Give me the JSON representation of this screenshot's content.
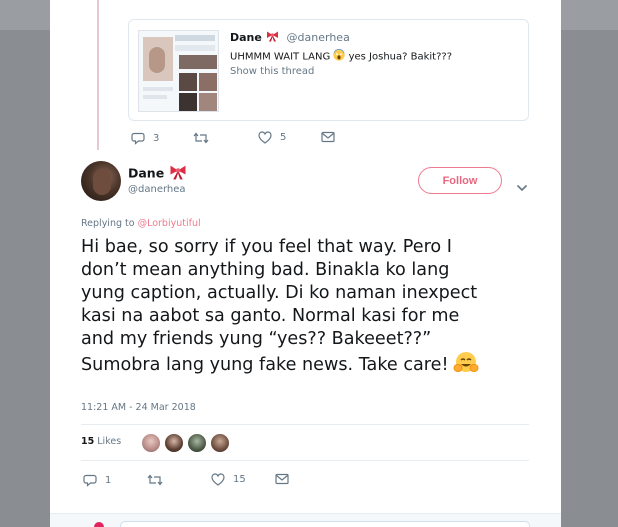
{
  "quoted_tweet": {
    "name": "Dane",
    "handle": "@danerhea",
    "text_before_emoji": "UHMMM WAIT LANG",
    "text_after_emoji": " yes Joshua? Bakit???",
    "show_thread_label": "Show this thread"
  },
  "previous_tweet_actions": {
    "reply_count": "3",
    "like_count": "5"
  },
  "tweet": {
    "author_name": "Dane",
    "author_handle": "@danerhea",
    "follow_label": "Follow",
    "replying_prefix": "Replying to ",
    "replying_handle": "@Lorbiyutiful",
    "body_lines": [
      "Hi bae, so sorry if you feel that way. Pero I",
      "don’t mean anything bad. Binakla ko lang",
      "yung caption, actually. Di ko naman inexpect",
      "kasi na aabot sa ganto. Normal kasi for me",
      "and my friends yung “yes?? Bakeeet??”",
      "Sumobra lang yung fake news. Take care!"
    ],
    "timestamp": "11:21 AM - 24 Mar 2018",
    "likes_count": "15",
    "likes_label": "Likes",
    "reply_count": "1",
    "like_count": "15"
  },
  "colors": {
    "accent": "#ef7a8f",
    "text": "#14171a",
    "muted": "#657786",
    "border": "#e6ecf0",
    "backdrop": "#8a8d91"
  },
  "icons": {
    "ribbon": "ribbon-emoji-icon",
    "scream": "screaming-face-emoji-icon",
    "hug": "hugging-face-emoji-icon",
    "reply": "reply-icon",
    "retweet": "retweet-icon",
    "like": "heart-icon",
    "message": "direct-message-icon",
    "caret": "chevron-down-icon"
  }
}
